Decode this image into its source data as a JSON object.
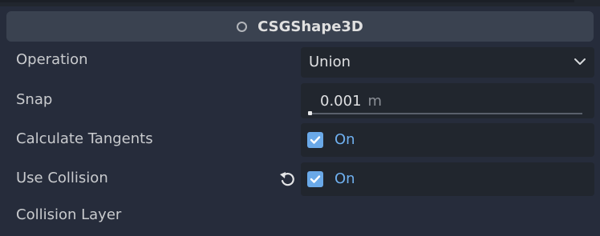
{
  "section": {
    "title": "CSGShape3D",
    "icon": "circle-icon"
  },
  "properties": {
    "operation": {
      "label": "Operation",
      "value": "Union"
    },
    "snap": {
      "label": "Snap",
      "value": "0.001",
      "unit": "m"
    },
    "calculate_tangents": {
      "label": "Calculate Tangents",
      "state": "On",
      "checked": true
    },
    "use_collision": {
      "label": "Use Collision",
      "state": "On",
      "checked": true
    },
    "collision_layer": {
      "label": "Collision Layer"
    }
  },
  "colors": {
    "background": "#262c3b",
    "field_background": "#21262e",
    "header_background": "#3a4250",
    "accent": "#6fb0f0"
  }
}
